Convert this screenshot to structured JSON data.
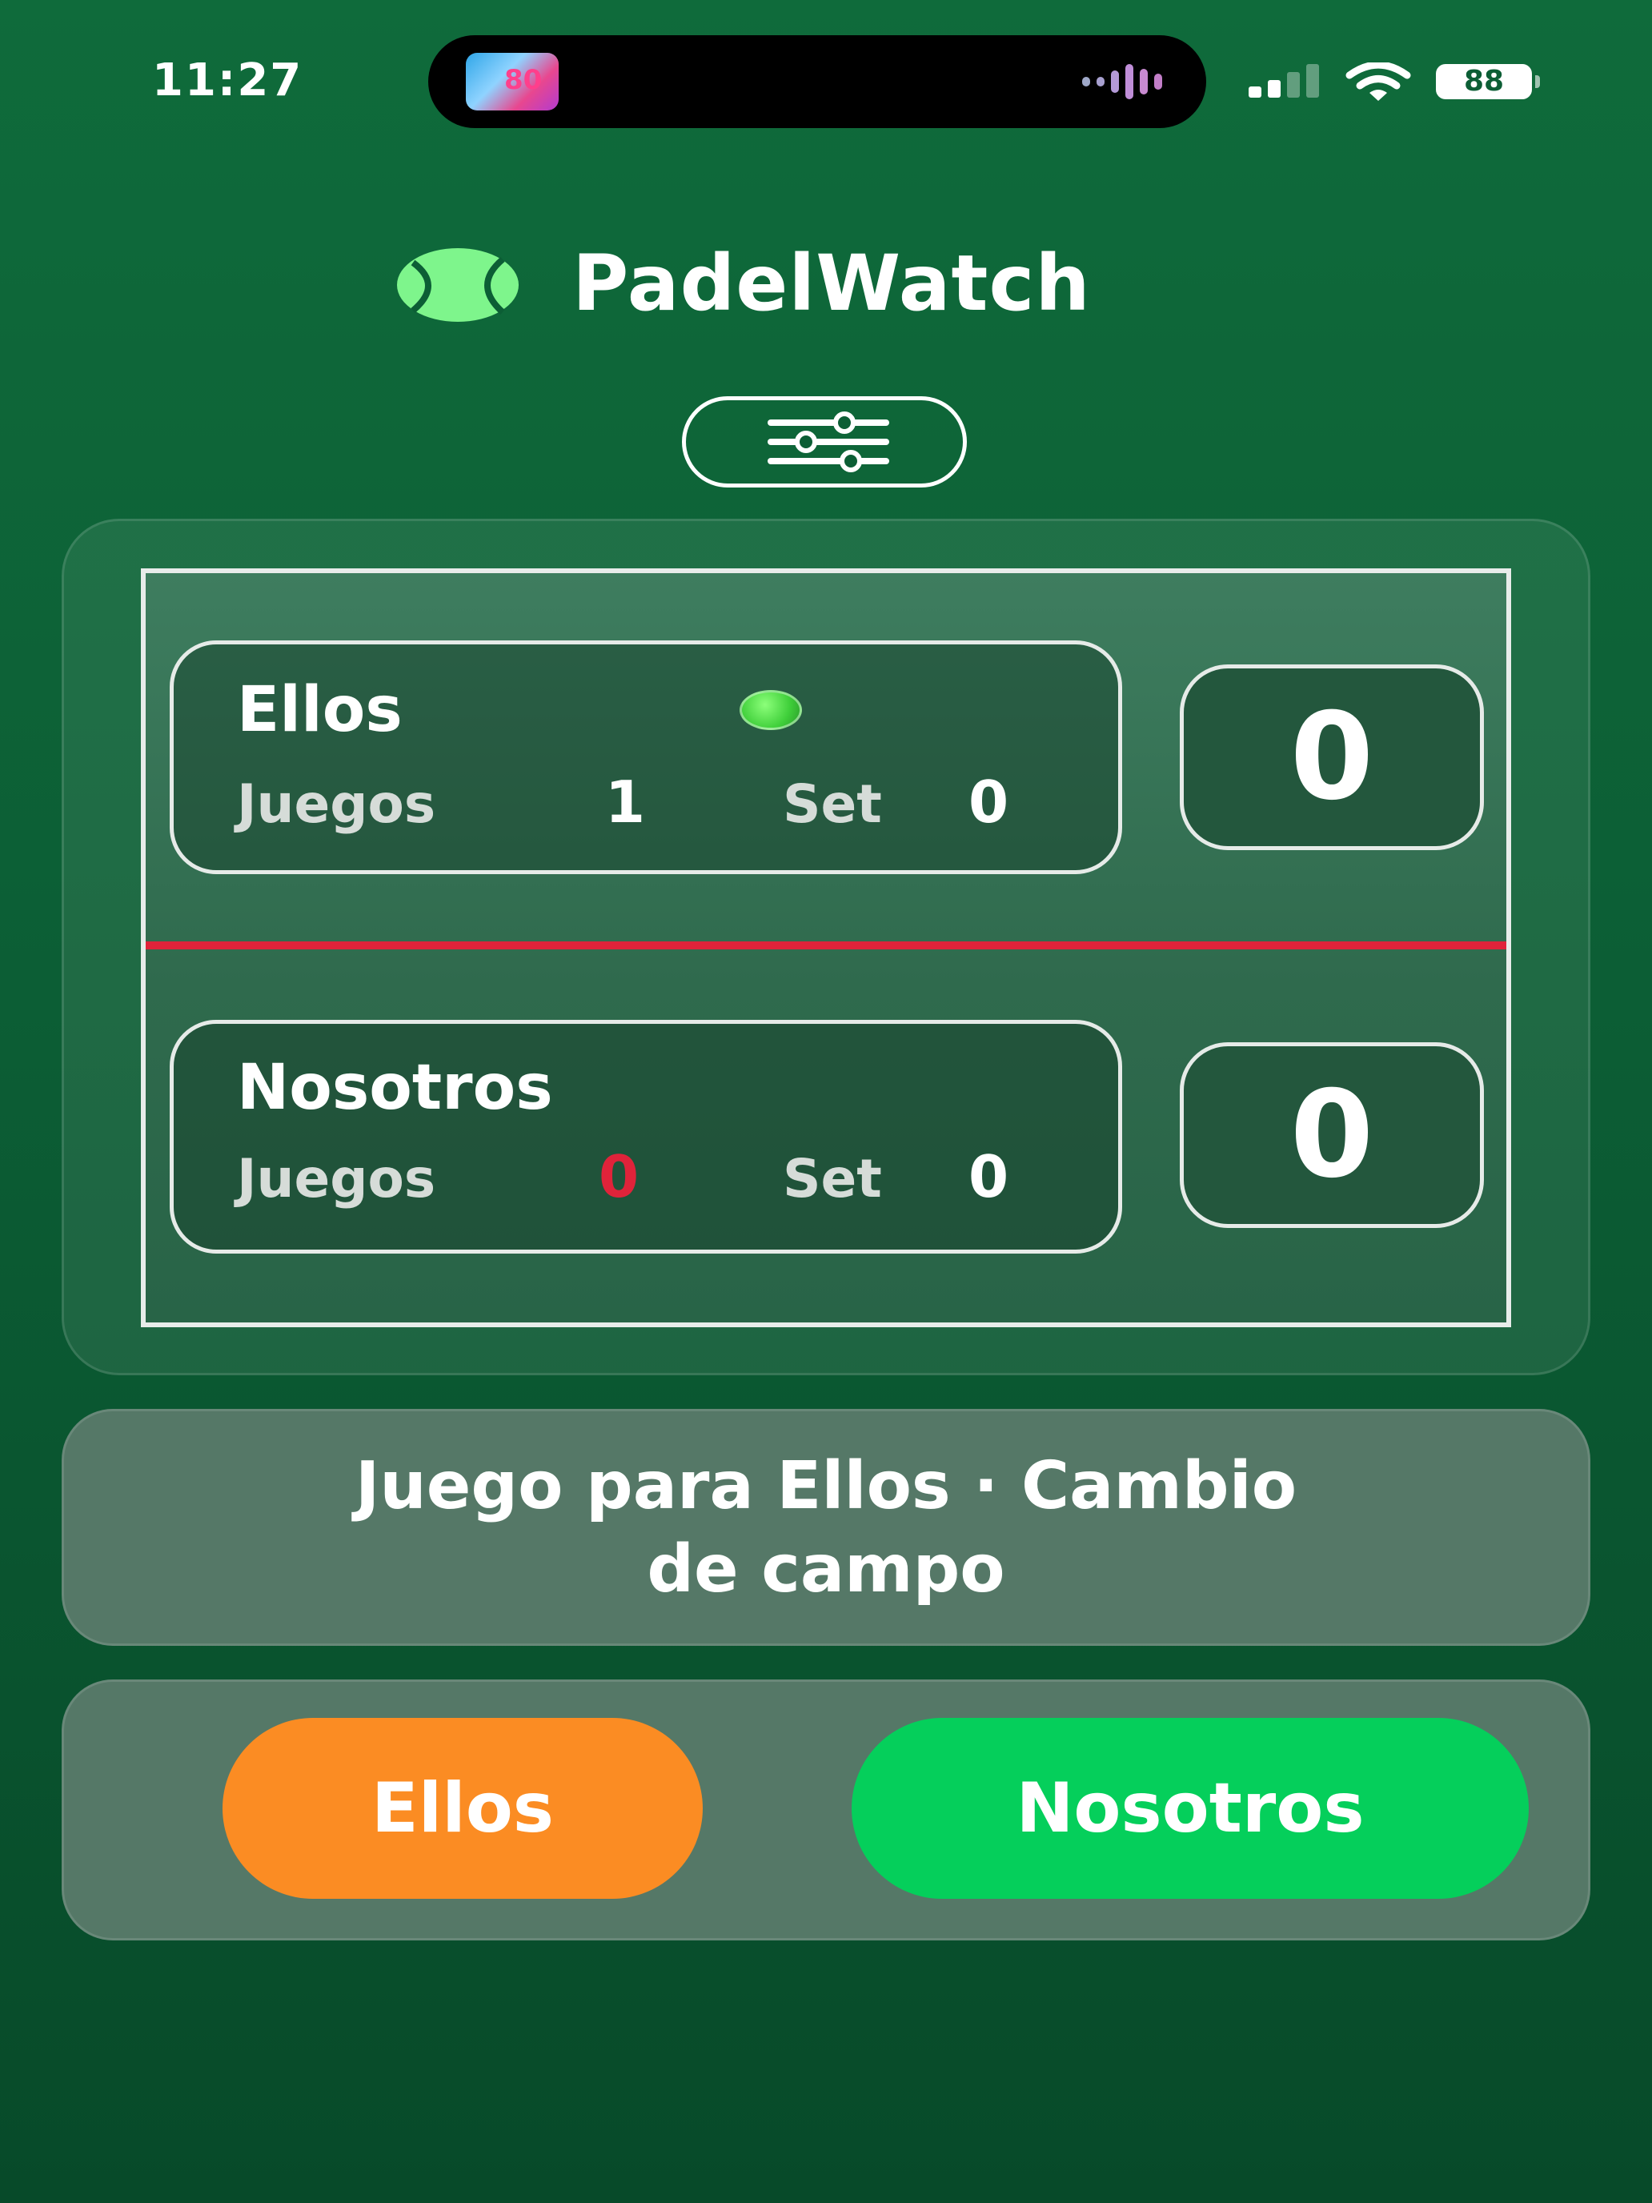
{
  "status_bar": {
    "time": "11:27",
    "battery": "88",
    "now_playing_art_text": "80"
  },
  "header": {
    "title": "PadelWatch"
  },
  "scoreboard": {
    "teams": [
      {
        "name": "Ellos",
        "games_label": "Juegos",
        "games": "1",
        "set_label": "Set",
        "sets": "0",
        "points": "0",
        "serving": true
      },
      {
        "name": "Nosotros",
        "games_label": "Juegos",
        "games": "0",
        "set_label": "Set",
        "sets": "0",
        "points": "0",
        "serving": false
      }
    ]
  },
  "message": {
    "line1": "Juego para Ellos · Cambio",
    "line2": "de campo"
  },
  "actions": {
    "team_a_label": "Ellos",
    "team_b_label": "Nosotros"
  },
  "colors": {
    "background": "#0c5e35",
    "net": "#e0233a",
    "button_ellos": "#fb8c23",
    "button_nosotros": "#05cf5b",
    "logo_ball": "#7ef58c"
  }
}
